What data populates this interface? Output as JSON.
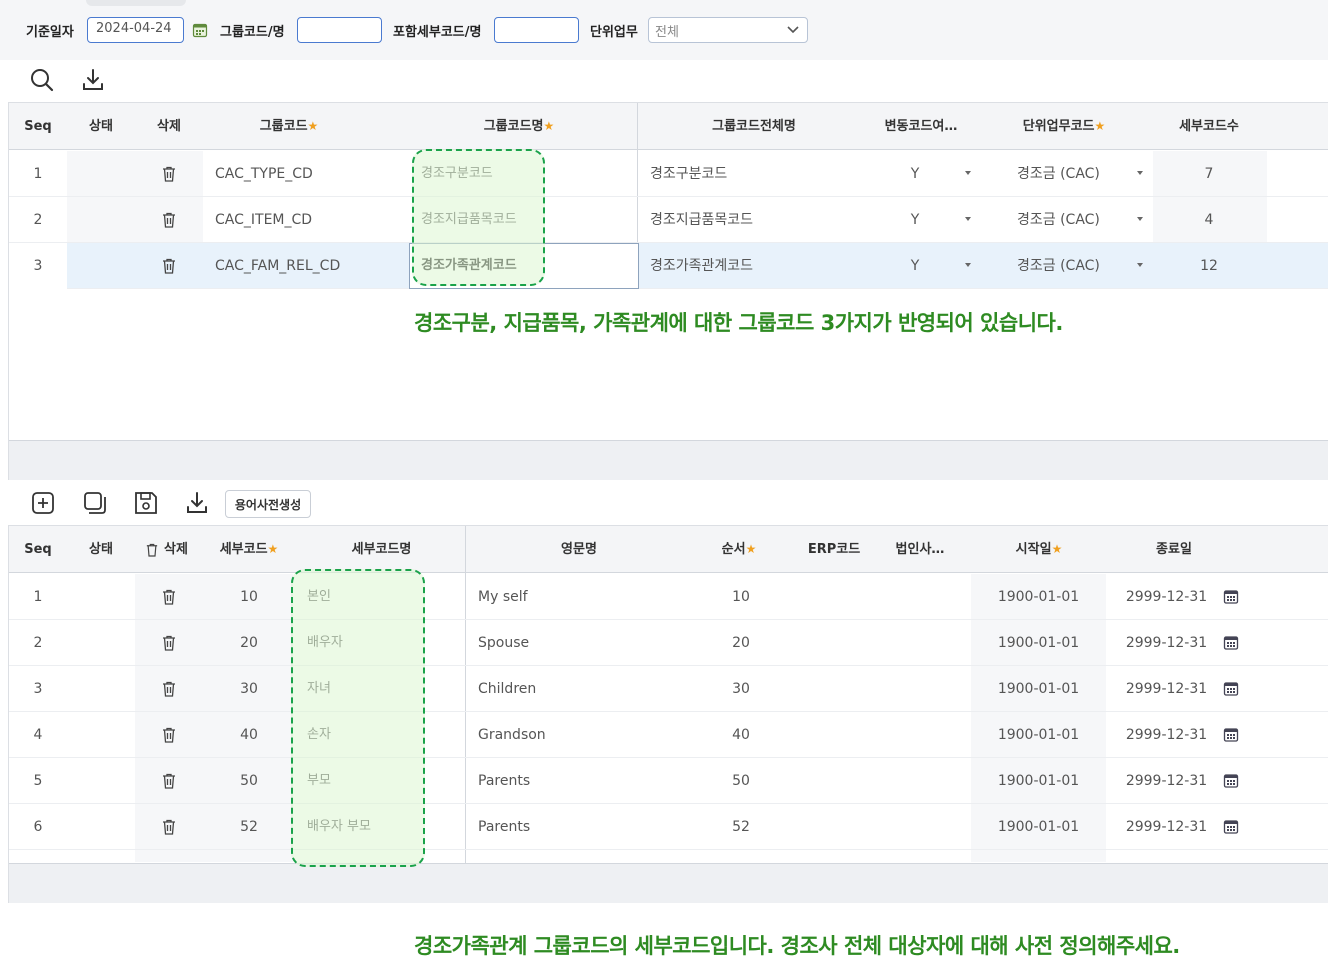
{
  "filter": {
    "base_date_label": "기준일자",
    "base_date_value": "2024-04-24",
    "group_code_label": "그룹코드/명",
    "group_code_value": "",
    "sub_code_label": "포함세부코드/명",
    "sub_code_value": "",
    "unit_task_label": "단위업무",
    "unit_task_value": "전체"
  },
  "group_grid": {
    "columns": {
      "seq": "Seq",
      "status": "상태",
      "delete": "삭제",
      "group_code": "그룹코드",
      "group_name": "그룹코드명",
      "full_name": "그룹코드전체명",
      "change_flag": "변동코드여…",
      "unit_task": "단위업무코드",
      "sub_count": "세부코드수"
    },
    "rows": [
      {
        "seq": "1",
        "code": "CAC_TYPE_CD",
        "name": "경조구분코드",
        "full_name": "경조구분코드",
        "flag": "Y",
        "unit": "경조금 (CAC)",
        "count": "7"
      },
      {
        "seq": "2",
        "code": "CAC_ITEM_CD",
        "name": "경조지급품목코드",
        "full_name": "경조지급품목코드",
        "flag": "Y",
        "unit": "경조금 (CAC)",
        "count": "4"
      },
      {
        "seq": "3",
        "code": "CAC_FAM_REL_CD",
        "name": "경조가족관계코드",
        "full_name": "경조가족관계코드",
        "flag": "Y",
        "unit": "경조금 (CAC)",
        "count": "12"
      }
    ],
    "note": "경조구분, 지급품목, 가족관계에 대한 그룹코드 3가지가 반영되어 있습니다."
  },
  "detail_toolbar": {
    "term_button": "용어사전생성"
  },
  "detail_grid": {
    "columns": {
      "seq": "Seq",
      "status": "상태",
      "delete": "삭제",
      "sub_code": "세부코드",
      "sub_name": "세부코드명",
      "eng_name": "영문명",
      "order": "순서",
      "erp": "ERP코드",
      "corp": "법인사…",
      "start": "시작일",
      "end": "종료일"
    },
    "rows": [
      {
        "seq": "1",
        "code": "10",
        "name": "본인",
        "eng": "My self",
        "order": "10",
        "start": "1900-01-01",
        "end": "2999-12-31"
      },
      {
        "seq": "2",
        "code": "20",
        "name": "배우자",
        "eng": "Spouse",
        "order": "20",
        "start": "1900-01-01",
        "end": "2999-12-31"
      },
      {
        "seq": "3",
        "code": "30",
        "name": "자녀",
        "eng": "Children",
        "order": "30",
        "start": "1900-01-01",
        "end": "2999-12-31"
      },
      {
        "seq": "4",
        "code": "40",
        "name": "손자",
        "eng": "Grandson",
        "order": "40",
        "start": "1900-01-01",
        "end": "2999-12-31"
      },
      {
        "seq": "5",
        "code": "50",
        "name": "부모",
        "eng": "Parents",
        "order": "50",
        "start": "1900-01-01",
        "end": "2999-12-31"
      },
      {
        "seq": "6",
        "code": "52",
        "name": "배우자 부모",
        "eng": "Parents",
        "order": "52",
        "start": "1900-01-01",
        "end": "2999-12-31"
      }
    ],
    "note": "경조가족관계 그룹코드의 세부코드입니다. 경조사 전체 대상자에 대해 사전 정의해주세요."
  },
  "colors": {
    "accent": "#4a7ad0",
    "highlight": "#1aa24a",
    "note": "#2e8b22",
    "star": "#f0a020"
  },
  "icons": [
    "calendar-icon",
    "chevron-down-icon",
    "search-icon",
    "download-icon",
    "trash-icon",
    "add-icon",
    "copy-icon",
    "save-icon",
    "calendar-grid-icon"
  ]
}
